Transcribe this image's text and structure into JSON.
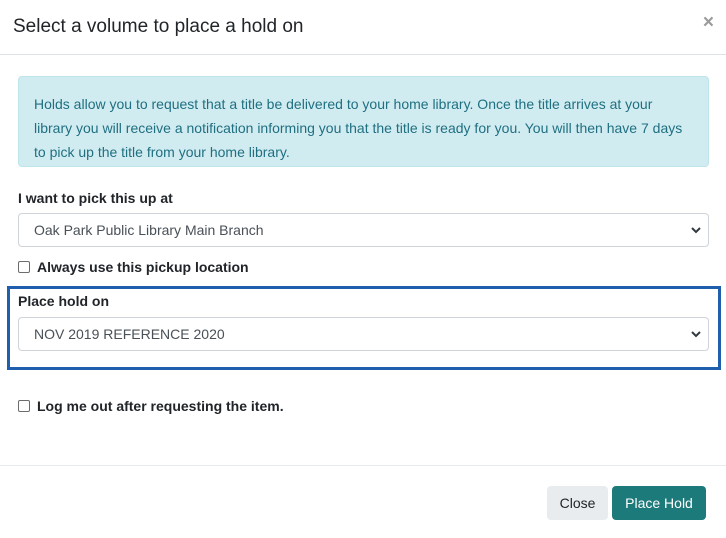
{
  "dialog": {
    "title": "Select a volume to place a hold on",
    "close_glyph": "×"
  },
  "info_alert": {
    "text": "Holds allow you to request that a title be delivered to your home library. Once the title arrives at your library you will receive a notification informing you that the title is ready for you. You will then have 7 days to pick up the title from your home library."
  },
  "pickup": {
    "label": "I want to pick this up at",
    "selected": "Oak Park Public Library Main Branch",
    "always_use_label": "Always use this pickup location",
    "always_use_checked": false
  },
  "volume": {
    "label": "Place hold on",
    "selected": "NOV 2019 REFERENCE 2020"
  },
  "logout": {
    "label": "Log me out after requesting the item.",
    "checked": false
  },
  "footer": {
    "close_label": "Close",
    "place_hold_label": "Place Hold"
  },
  "colors": {
    "primary_button": "#1d7a7a",
    "alert_background": "#d1ecf1",
    "highlight_border": "#1f5fad"
  },
  "icons": {
    "close": "close-icon",
    "select_chevron": "chevron-down-icon"
  }
}
